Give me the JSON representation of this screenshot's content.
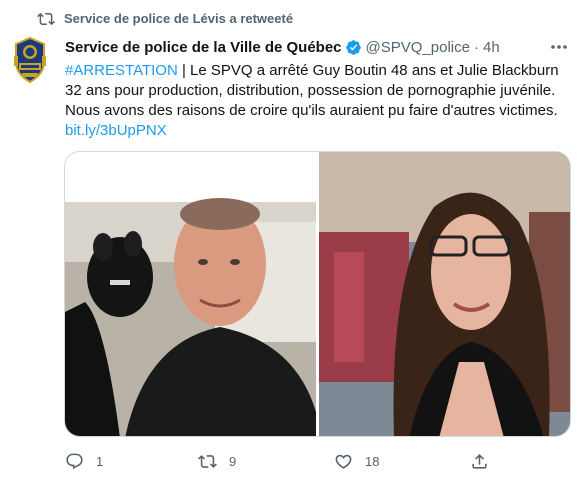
{
  "retweet_banner": {
    "text": "Service de police de Lévis a retweeté",
    "icon": "retweet-icon"
  },
  "tweet": {
    "author": {
      "display_name": "Service de police de la Ville de Québec",
      "handle": "@SPVQ_police",
      "verified": true,
      "avatar_icon": "police-badge-logo"
    },
    "separator": "·",
    "time": "4h",
    "text": {
      "hashtag": "#ARRESTATION",
      "body": " | Le SPVQ a arrêté Guy Boutin 48 ans et Julie Blackburn 32 ans pour production, distribution, possession de pornographie juvénile. Nous avons des raisons de croire qu'ils auraient pu faire d'autres victimes.",
      "link": "bit.ly/3bUpPNX"
    },
    "media": [
      {
        "description_icon": "photo-man-with-dog"
      },
      {
        "description_icon": "photo-woman-with-glasses"
      }
    ],
    "actions": {
      "reply": {
        "icon": "reply-icon",
        "count": "1"
      },
      "retweet": {
        "icon": "retweet-icon",
        "count": "9"
      },
      "like": {
        "icon": "heart-icon",
        "count": "18"
      },
      "share": {
        "icon": "share-icon",
        "count": ""
      }
    }
  },
  "colors": {
    "accent": "#1d9bf0",
    "text": "#0f1419",
    "secondary": "#536471",
    "border": "#cfd9de"
  }
}
